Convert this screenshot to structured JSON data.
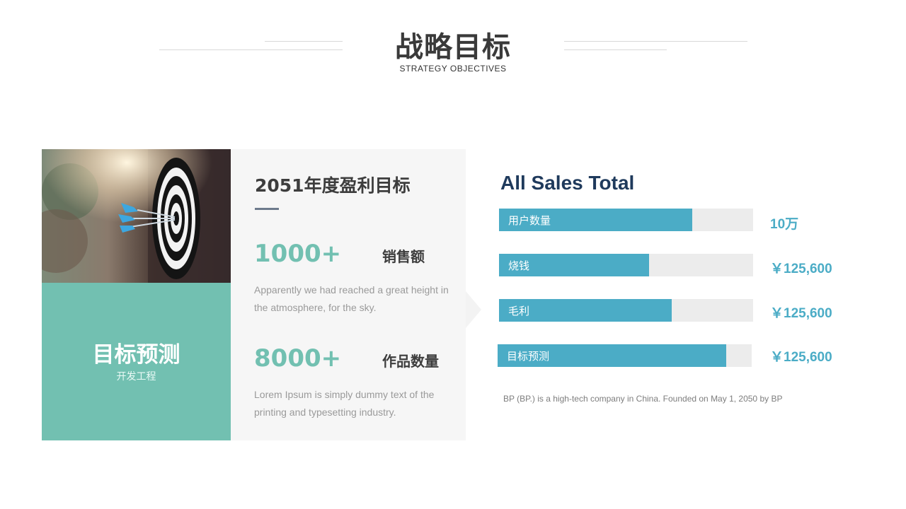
{
  "header": {
    "title": "战略目标",
    "subtitle": "STRATEGY  OBJECTIVES"
  },
  "card": {
    "title": "目标预测",
    "subtitle": "开发工程",
    "accent_color": "#72c0b1"
  },
  "panel": {
    "title": "2051年度盈利目标",
    "stats": [
      {
        "value": "1000+",
        "label": "销售额",
        "description": "Apparently we  had reached a great height in the atmosphere, for the sky."
      },
      {
        "value": "8000+",
        "label": "作品数量",
        "description": "Lorem Ipsum  is simply dummy  text of the printing and typesetting industry."
      }
    ]
  },
  "sales": {
    "title": "All Sales Total",
    "bar_color": "#4bacc6",
    "bars": [
      {
        "label": "用户数量",
        "value": "10万",
        "progress": 0.76
      },
      {
        "label": "烧钱",
        "value": "￥125,600",
        "progress": 0.59
      },
      {
        "label": "毛利",
        "value": "￥125,600",
        "progress": 0.68
      },
      {
        "label": "目标预测",
        "value": "￥125,600",
        "progress": 0.9
      }
    ],
    "footnote": "BP (BP.) is a high-tech company in China. Founded on May  1, 2050 by BP"
  }
}
